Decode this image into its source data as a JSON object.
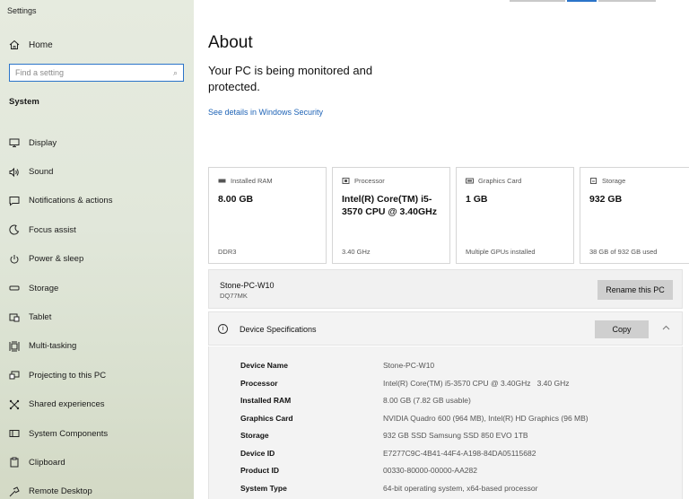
{
  "app_title": "Settings",
  "sidebar": {
    "home_label": "Home",
    "search_placeholder": "Find a setting",
    "section_label": "System",
    "items": [
      {
        "label": "Display",
        "icon": "display-icon"
      },
      {
        "label": "Sound",
        "icon": "sound-icon"
      },
      {
        "label": "Notifications & actions",
        "icon": "notifications-icon"
      },
      {
        "label": "Focus assist",
        "icon": "focus-assist-icon"
      },
      {
        "label": "Power & sleep",
        "icon": "power-icon"
      },
      {
        "label": "Storage",
        "icon": "storage-icon"
      },
      {
        "label": "Tablet",
        "icon": "tablet-icon"
      },
      {
        "label": "Multi-tasking",
        "icon": "multitasking-icon"
      },
      {
        "label": "Projecting to this PC",
        "icon": "projecting-icon"
      },
      {
        "label": "Shared experiences",
        "icon": "shared-experiences-icon"
      },
      {
        "label": "System Components",
        "icon": "system-components-icon"
      },
      {
        "label": "Clipboard",
        "icon": "clipboard-icon"
      },
      {
        "label": "Remote Desktop",
        "icon": "remote-desktop-icon"
      }
    ]
  },
  "main": {
    "title": "About",
    "monitor_text": "Your PC is being monitored and protected.",
    "security_link": "See details in Windows Security",
    "cards": [
      {
        "label": "Installed RAM",
        "value": "8.00 GB",
        "foot": "DDR3",
        "icon": "ram-icon"
      },
      {
        "label": "Processor",
        "value": "Intel(R) Core(TM) i5-3570 CPU @ 3.40GHz",
        "foot": "3.40 GHz",
        "icon": "processor-icon"
      },
      {
        "label": "Graphics Card",
        "value": "1 GB",
        "foot": "Multiple GPUs installed",
        "icon": "graphics-card-icon"
      },
      {
        "label": "Storage",
        "value": "932 GB",
        "foot": "38 GB of 932 GB used",
        "icon": "storage-drive-icon"
      }
    ],
    "pc_name": "Stone-PC-W10",
    "pc_subtitle": "DQ77MK",
    "rename_label": "Rename this PC",
    "spec_title": "Device Specifications",
    "copy_label": "Copy",
    "specs": [
      {
        "key": "Device Name",
        "value": "Stone-PC-W10"
      },
      {
        "key": "Processor",
        "value": "Intel(R) Core(TM) i5-3570 CPU @ 3.40GHz   3.40 GHz"
      },
      {
        "key": "Installed RAM",
        "value": "8.00 GB (7.82 GB usable)"
      },
      {
        "key": "Graphics Card",
        "value": "NVIDIA Quadro 600 (964 MB), Intel(R) HD Graphics (96 MB)"
      },
      {
        "key": "Storage",
        "value": "932 GB SSD Samsung SSD 850 EVO 1TB"
      },
      {
        "key": "Device ID",
        "value": "E7277C9C-4B41-44F4-A198-84DA05115682"
      },
      {
        "key": "Product ID",
        "value": "00330-80000-00000-AA282"
      },
      {
        "key": "System Type",
        "value": "64-bit operating system, x64-based processor"
      }
    ]
  },
  "colors": {
    "accent": "#2b74c9",
    "link": "#1e63b6",
    "sidebar_bg": "#e1e7da",
    "button_bg": "#cfcfcf"
  }
}
